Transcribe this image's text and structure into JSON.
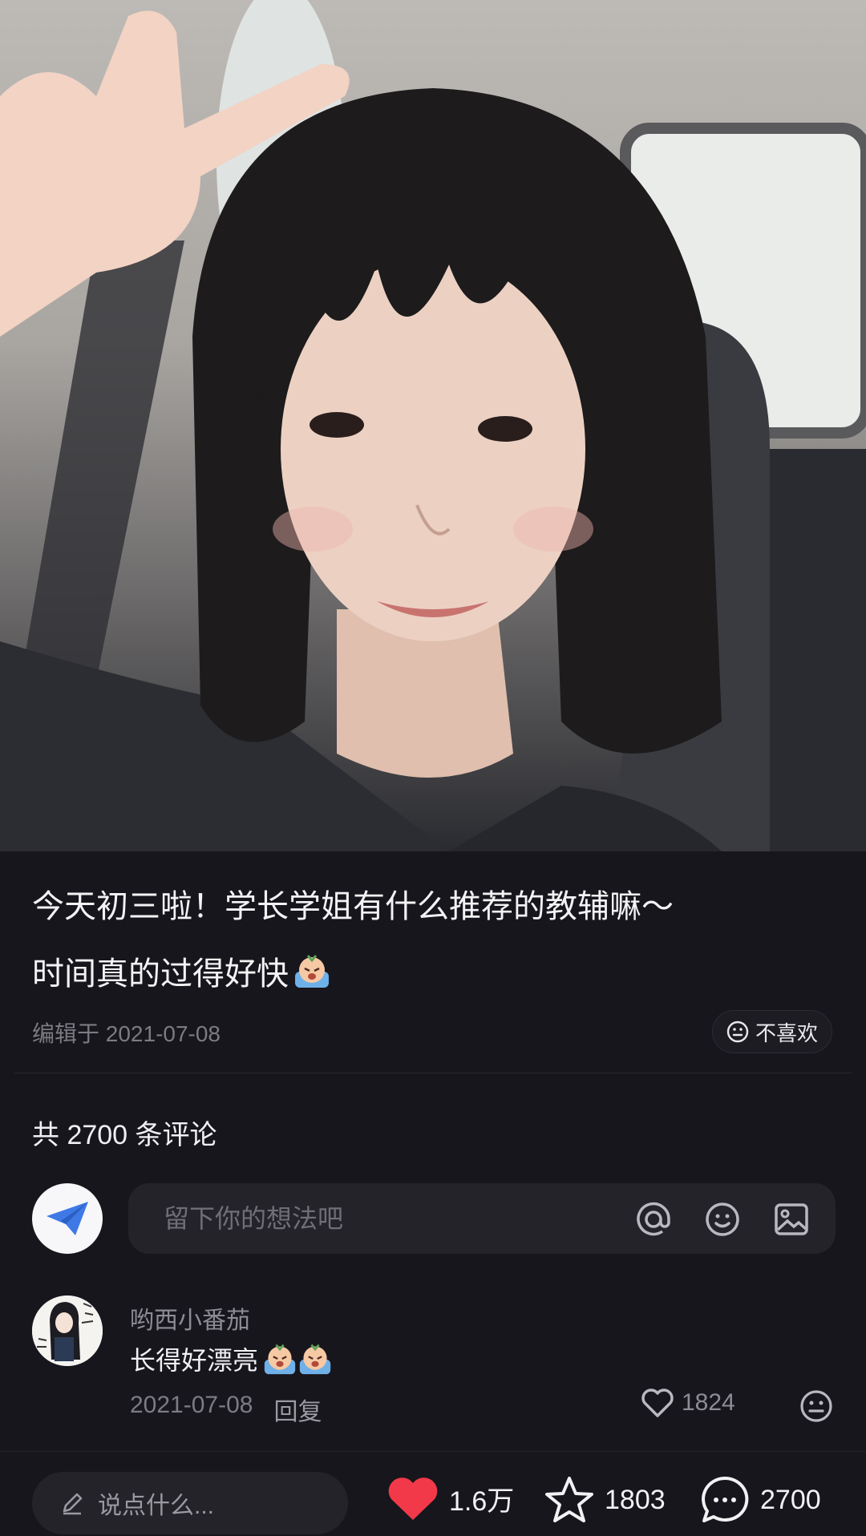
{
  "post": {
    "title": "今天初三啦！学长学姐有什么推荐的教辅嘛～",
    "subtitle": "时间真的过得好快",
    "edited": "编辑于 2021-07-08",
    "dislike_label": "不喜欢"
  },
  "comments": {
    "count_label": "共 2700 条评论",
    "input_placeholder": "留下你的想法吧",
    "items": [
      {
        "username": "哟西小番茄",
        "text": "长得好漂亮",
        "date": "2021-07-08",
        "reply_label": "回复",
        "likes": "1824"
      }
    ]
  },
  "bottom_bar": {
    "say_placeholder": "说点什么...",
    "likes": "1.6万",
    "favorites": "1803",
    "comments": "2700"
  },
  "colors": {
    "background": "#17161c",
    "heart": "#f2394a",
    "input_bg": "#24232a"
  },
  "icons": [
    "photo",
    "cry-emoji",
    "neutral-face-icon",
    "paper-plane-icon",
    "at-icon",
    "smile-icon",
    "image-icon",
    "heart-outline-icon",
    "pencil-icon",
    "heart-filled-icon",
    "star-icon",
    "comment-bubble-icon"
  ]
}
